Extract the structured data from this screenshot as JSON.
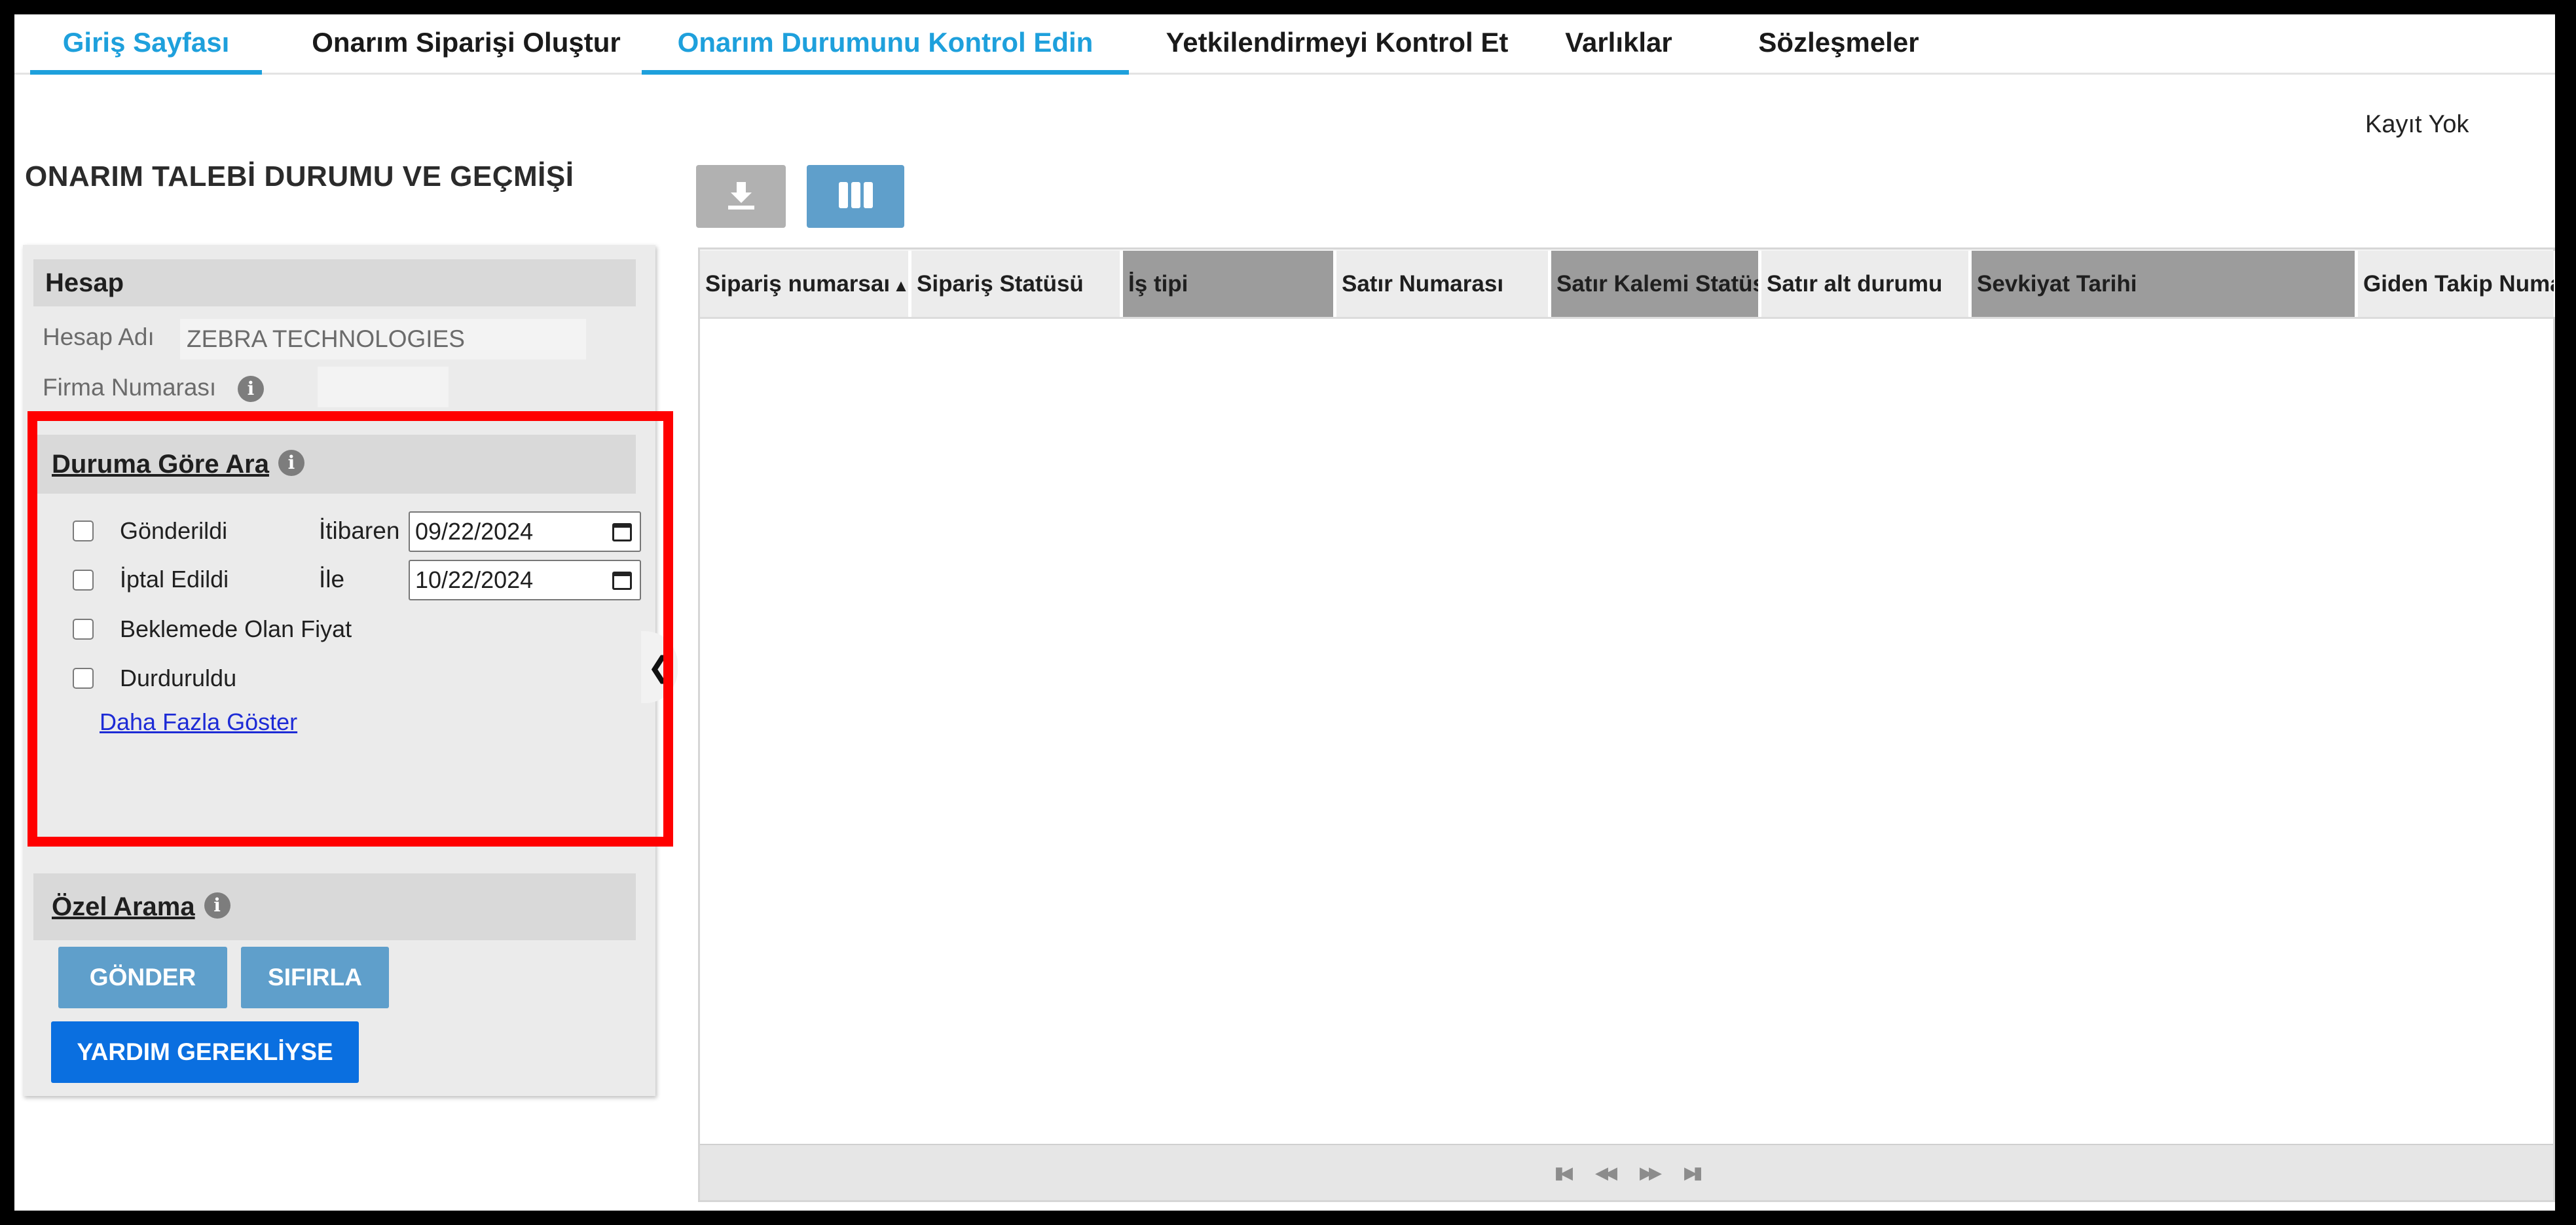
{
  "nav": {
    "tabs": [
      {
        "label": "Giriş Sayfası",
        "active": true
      },
      {
        "label": "Onarım Siparişi Oluştur",
        "active": false
      },
      {
        "label": "Onarım Durumunu Kontrol Edin",
        "active": true
      },
      {
        "label": "Yetkilendirmeyi Kontrol Et",
        "active": false
      },
      {
        "label": "Varlıklar",
        "active": false
      },
      {
        "label": "Sözleşmeler",
        "active": false
      }
    ],
    "active_color": "#1ea0dc"
  },
  "page_title": "ONARIM TALEBİ DURUMU VE GEÇMİŞİ",
  "records_status": "Kayıt Yok",
  "toolbar": {
    "download_icon": "download-icon",
    "columns_icon": "columns-icon"
  },
  "account": {
    "heading": "Hesap",
    "account_name_label": "Hesap Adı",
    "account_name_value": "ZEBRA TECHNOLOGIES",
    "firm_number_label": "Firma Numarası",
    "firm_number_value": ""
  },
  "status_search": {
    "heading": "Duruma Göre Ara",
    "options": [
      {
        "label": "Gönderildi",
        "checked": false
      },
      {
        "label": "İptal Edildi",
        "checked": false
      },
      {
        "label": "Beklemede Olan Fiyat",
        "checked": false
      },
      {
        "label": "Durduruldu",
        "checked": false
      }
    ],
    "from_label": "İtibaren",
    "from_value": "09/22/2024",
    "to_label": "İle",
    "to_value": "10/22/2024",
    "show_more": "Daha Fazla Göster"
  },
  "custom_search": {
    "heading": "Özel Arama"
  },
  "buttons": {
    "submit": "GÖNDER",
    "reset": "SIFIRLA",
    "help": "YARDIM GEREKLİYSE"
  },
  "grid": {
    "columns": [
      {
        "label": "Sipariş numarsaı",
        "sorted": "asc"
      },
      {
        "label": "Sipariş Statüsü"
      },
      {
        "label": "İş tipi"
      },
      {
        "label": "Satır Numarası"
      },
      {
        "label": "Satır Kalemi Statüsü"
      },
      {
        "label": "Satır alt durumu"
      },
      {
        "label": "Sevkiyat Tarihi"
      },
      {
        "label": "Giden Takip Numarası"
      }
    ],
    "rows": []
  },
  "colors": {
    "highlight": "#ff0000",
    "primary_button": "#5f9fcb",
    "help_button": "#0a6fe0",
    "link": "#1d2bd6"
  }
}
